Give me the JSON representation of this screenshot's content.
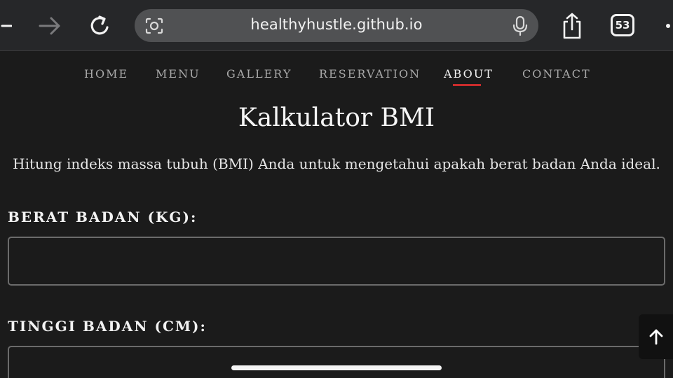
{
  "browser": {
    "url": "healthyhustle.github.io",
    "tab_count": "53",
    "icons": [
      "back-icon",
      "forward-icon",
      "reload-icon",
      "camera-lens-icon",
      "microphone-icon",
      "share-icon",
      "tabs-icon",
      "more-icon"
    ]
  },
  "nav": {
    "items": [
      {
        "label": "HOME"
      },
      {
        "label": "MENU"
      },
      {
        "label": "GALLERY"
      },
      {
        "label": "RESERVATION"
      },
      {
        "label": "ABOUT"
      },
      {
        "label": "CONTACT"
      }
    ],
    "active": "ABOUT"
  },
  "page": {
    "title": "Kalkulator BMI",
    "description": "Hitung indeks massa tubuh (BMI) Anda untuk mengetahui apakah berat badan Anda ideal."
  },
  "form": {
    "weight_label": "BERAT BADAN (KG):",
    "weight_value": "",
    "height_label": "TINGGI BADAN (CM):",
    "height_value": ""
  },
  "colors": {
    "background": "#1b1b1b",
    "accent": "#c92c2c",
    "browser_bar": "#262729"
  }
}
